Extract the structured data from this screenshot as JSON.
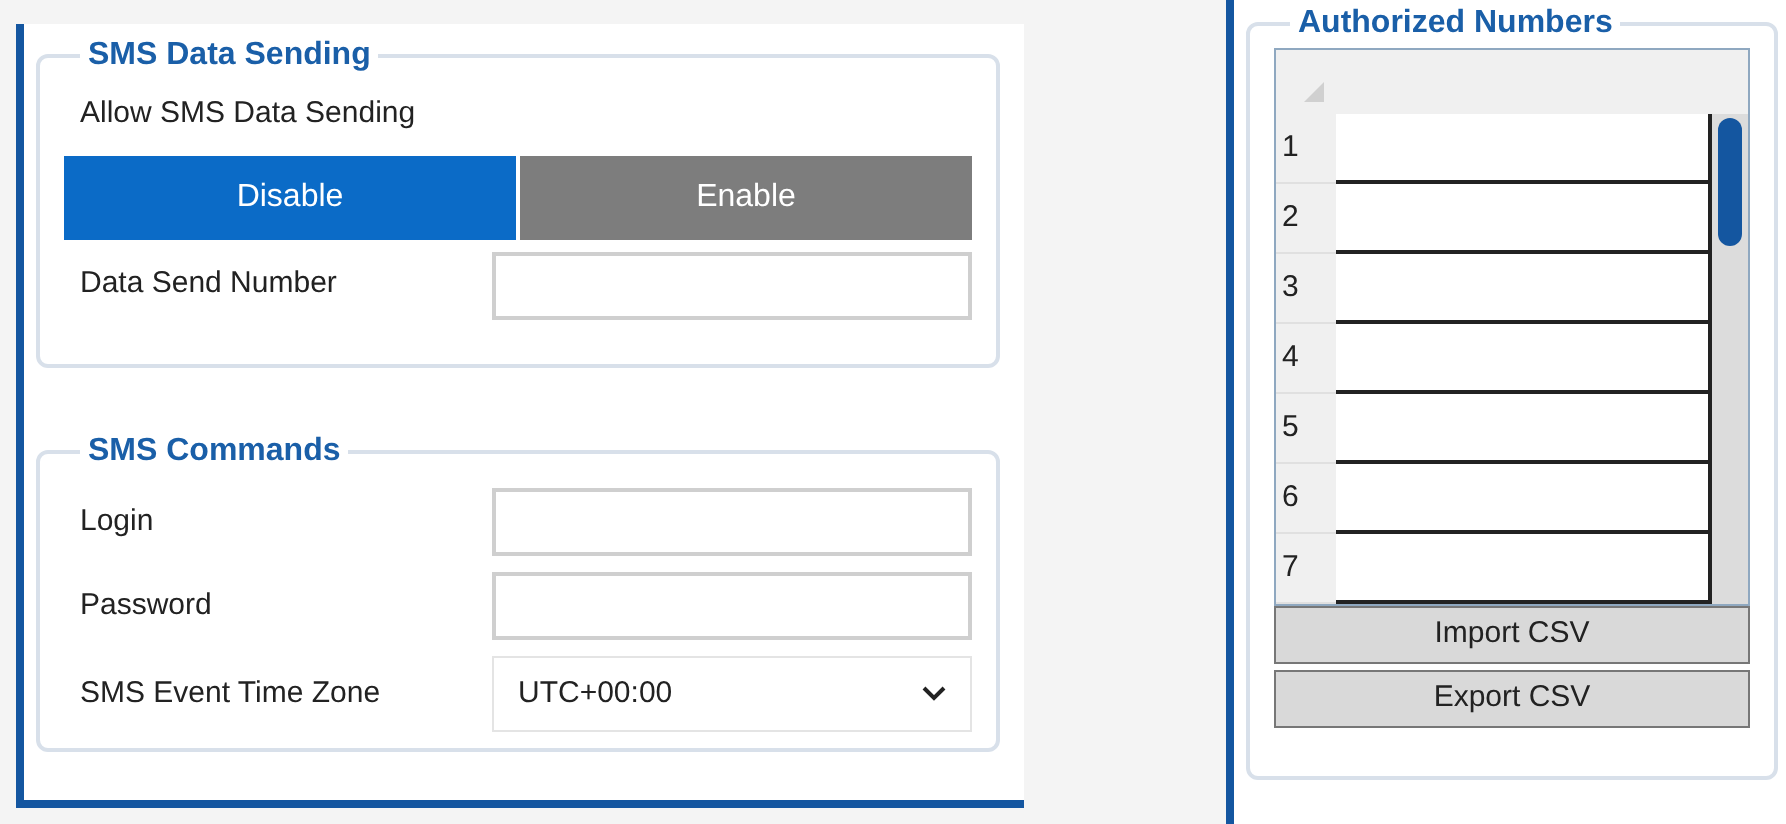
{
  "sms_data_sending": {
    "title": "SMS Data Sending",
    "allow_label": "Allow SMS Data Sending",
    "allow_options": [
      {
        "label": "Disable",
        "selected": true
      },
      {
        "label": "Enable",
        "selected": false
      }
    ],
    "data_send_number": {
      "label": "Data Send Number"
    }
  },
  "sms_commands": {
    "title": "SMS Commands",
    "fields": [
      {
        "kind": "text",
        "label": "Login"
      },
      {
        "kind": "password",
        "label": "Password"
      },
      {
        "kind": "select",
        "label": "SMS Event Time Zone",
        "value": "UTC+00:00"
      }
    ]
  },
  "authorized_numbers": {
    "title": "Authorized Numbers",
    "rows": [
      "1",
      "2",
      "3",
      "4",
      "5",
      "6",
      "7"
    ],
    "buttons": [
      "Import CSV",
      "Export CSV"
    ]
  }
}
